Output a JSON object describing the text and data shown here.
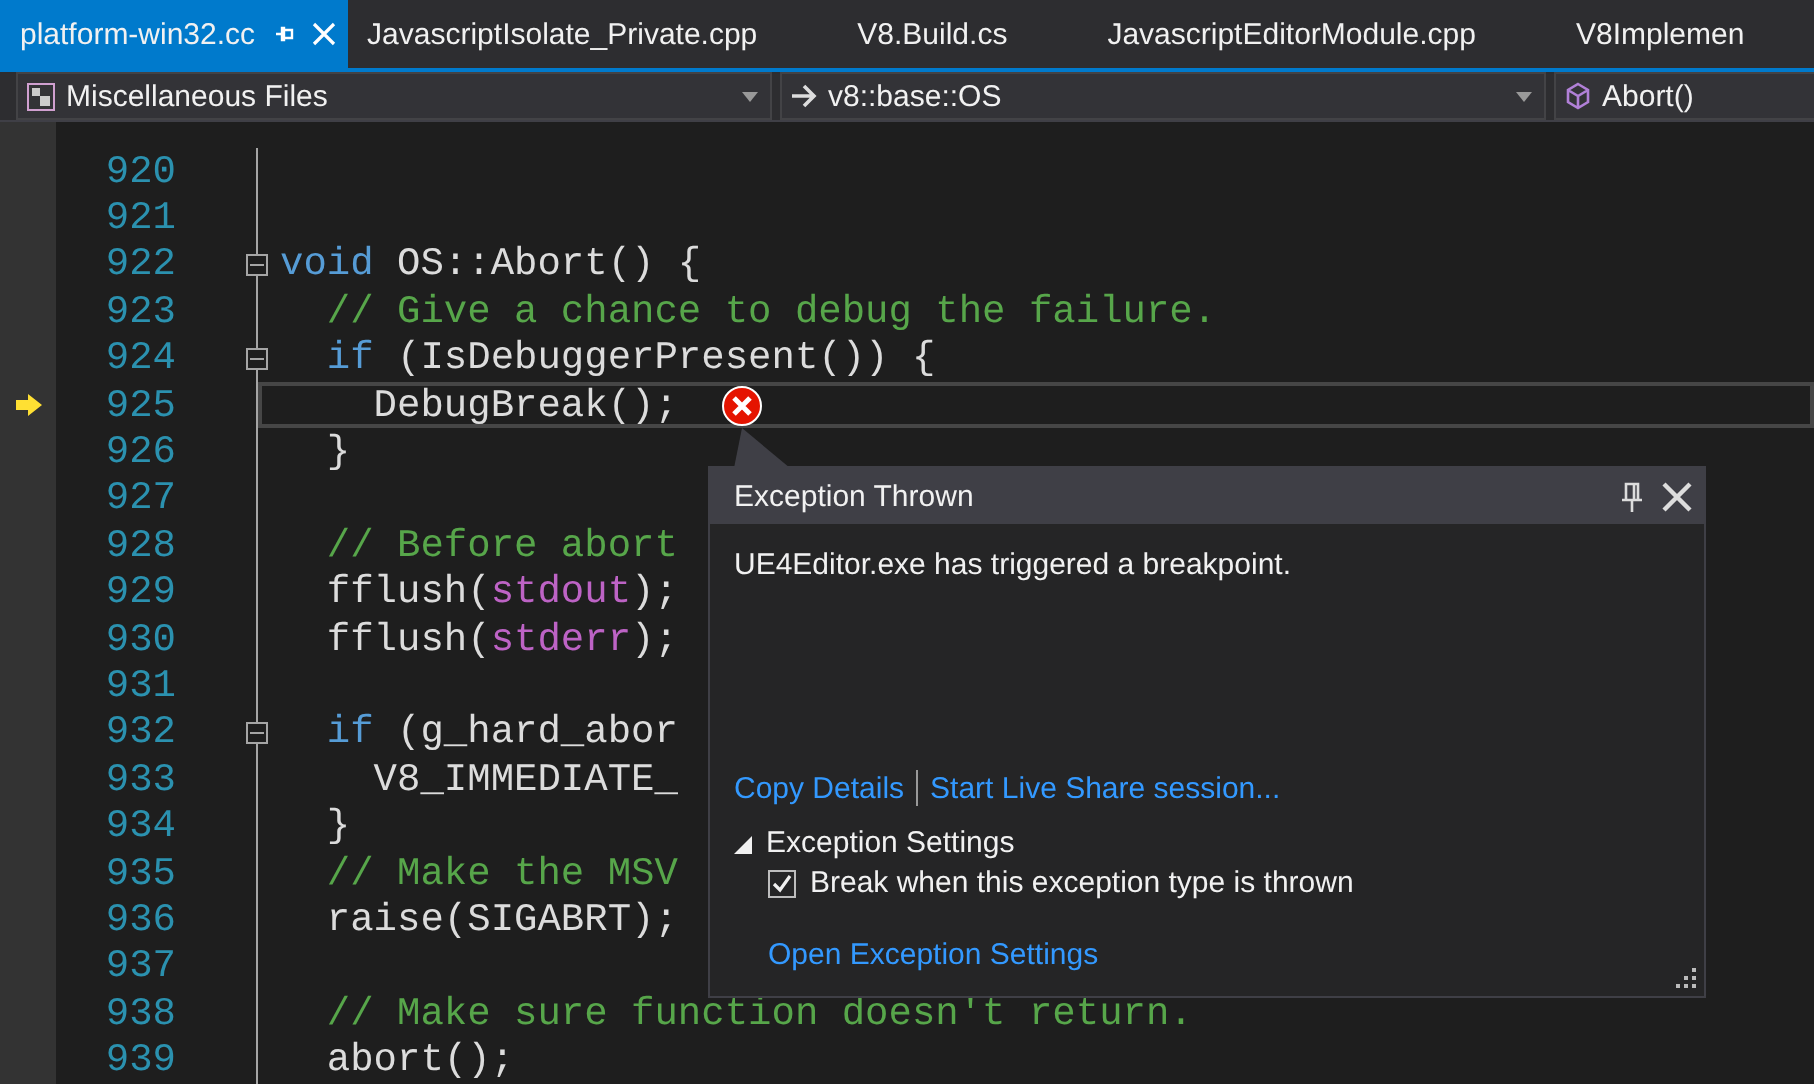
{
  "tabs": [
    {
      "label": "platform-win32.cc",
      "selected": true
    },
    {
      "label": "JavascriptIsolate_Private.cpp",
      "selected": false
    },
    {
      "label": "V8.Build.cs",
      "selected": false
    },
    {
      "label": "JavascriptEditorModule.cpp",
      "selected": false
    },
    {
      "label": "V8Implemen",
      "selected": false
    }
  ],
  "navbar": {
    "project": "Miscellaneous Files",
    "scope": "v8::base::OS",
    "member": "Abort()"
  },
  "code_lines": [
    {
      "number": "920",
      "foldable": false,
      "current": false,
      "exception": false
    },
    {
      "number": "921",
      "foldable": false,
      "current": false,
      "exception": false
    },
    {
      "number": "922",
      "foldable": true,
      "current": false,
      "exception": false,
      "tokens": [
        {
          "kind": "keyword",
          "text": "void"
        },
        {
          "kind": "plain",
          "text": " OS::Abort() {"
        }
      ]
    },
    {
      "number": "923",
      "foldable": false,
      "current": false,
      "exception": false,
      "tokens": [
        {
          "kind": "comment",
          "text": "  // Give a chance to debug the failure."
        }
      ]
    },
    {
      "number": "924",
      "foldable": true,
      "current": false,
      "exception": false,
      "tokens": [
        {
          "kind": "keyword",
          "text": "  if"
        },
        {
          "kind": "plain",
          "text": " (IsDebuggerPresent()) {"
        }
      ]
    },
    {
      "number": "925",
      "foldable": false,
      "current": true,
      "exception": true,
      "tokens": [
        {
          "kind": "plain",
          "text": "    DebugBreak();"
        }
      ]
    },
    {
      "number": "926",
      "foldable": false,
      "current": false,
      "exception": false,
      "tokens": [
        {
          "kind": "plain",
          "text": "  }"
        }
      ]
    },
    {
      "number": "927",
      "foldable": false,
      "current": false,
      "exception": false
    },
    {
      "number": "928",
      "foldable": false,
      "current": false,
      "exception": false,
      "tokens": [
        {
          "kind": "comment",
          "text": "  // Before abort"
        }
      ]
    },
    {
      "number": "929",
      "foldable": false,
      "current": false,
      "exception": false,
      "tokens": [
        {
          "kind": "plain",
          "text": "  fflush("
        },
        {
          "kind": "macro",
          "text": "stdout"
        },
        {
          "kind": "plain",
          "text": ");"
        }
      ]
    },
    {
      "number": "930",
      "foldable": false,
      "current": false,
      "exception": false,
      "tokens": [
        {
          "kind": "plain",
          "text": "  fflush("
        },
        {
          "kind": "macro",
          "text": "stderr"
        },
        {
          "kind": "plain",
          "text": ");"
        }
      ]
    },
    {
      "number": "931",
      "foldable": false,
      "current": false,
      "exception": false
    },
    {
      "number": "932",
      "foldable": true,
      "current": false,
      "exception": false,
      "tokens": [
        {
          "kind": "keyword",
          "text": "  if"
        },
        {
          "kind": "plain",
          "text": " (g_hard_abor"
        }
      ]
    },
    {
      "number": "933",
      "foldable": false,
      "current": false,
      "exception": false,
      "tokens": [
        {
          "kind": "plain",
          "text": "    V8_IMMEDIATE_"
        }
      ]
    },
    {
      "number": "934",
      "foldable": false,
      "current": false,
      "exception": false,
      "tokens": [
        {
          "kind": "plain",
          "text": "  }"
        }
      ]
    },
    {
      "number": "935",
      "foldable": false,
      "current": false,
      "exception": false,
      "tokens": [
        {
          "kind": "comment",
          "text": "  // Make the MSV"
        }
      ]
    },
    {
      "number": "936",
      "foldable": false,
      "current": false,
      "exception": false,
      "tokens": [
        {
          "kind": "plain",
          "text": "  raise(SIGABRT);"
        }
      ]
    },
    {
      "number": "937",
      "foldable": false,
      "current": false,
      "exception": false
    },
    {
      "number": "938",
      "foldable": false,
      "current": false,
      "exception": false,
      "tokens": [
        {
          "kind": "comment",
          "text": "  // Make sure function doesn't return."
        }
      ]
    },
    {
      "number": "939",
      "foldable": false,
      "current": false,
      "exception": false,
      "tokens": [
        {
          "kind": "plain",
          "text": "  abort();"
        }
      ]
    }
  ],
  "exception_popup": {
    "title": "Exception Thrown",
    "message": "UE4Editor.exe has triggered a breakpoint.",
    "links": [
      "Copy Details",
      "Start Live Share session..."
    ],
    "settings": {
      "label": "Exception Settings",
      "expanded": true,
      "option": {
        "label": "Break when this exception type is thrown",
        "checked": true
      },
      "link": "Open Exception Settings"
    }
  }
}
